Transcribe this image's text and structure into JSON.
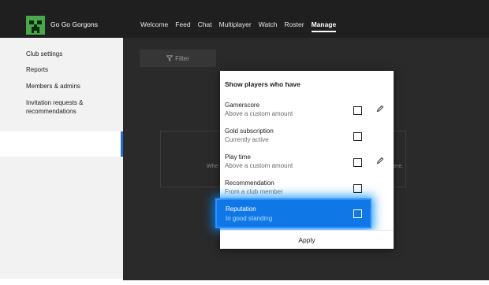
{
  "club": {
    "name": "Go Go Gorgons",
    "logo_icon": "creeper-face-icon"
  },
  "nav": {
    "items": [
      "Welcome",
      "Feed",
      "Chat",
      "Multiplayer",
      "Watch",
      "Roster",
      "Manage"
    ],
    "active": "Manage"
  },
  "sidebar": {
    "items": [
      {
        "label": "Club settings"
      },
      {
        "label": "Reports"
      },
      {
        "label": "Members & admins"
      },
      {
        "label": "Invitation requests &",
        "label2": "recommendations",
        "selected": true
      }
    ]
  },
  "main": {
    "filter_label": "Filter",
    "filter_icon": "filter-funnel-icon",
    "empty_left": "Whe",
    "empty_right": "ere."
  },
  "filter_panel": {
    "title": "Show players who have",
    "options": [
      {
        "title": "Gamerscore",
        "subtitle": "Above a custom amount",
        "checked": false,
        "editable": true
      },
      {
        "title": "Gold subscription",
        "subtitle": "Currently active",
        "checked": false,
        "editable": false
      },
      {
        "title": "Play time",
        "subtitle": "Above a custom amount",
        "checked": false,
        "editable": true
      },
      {
        "title": "Recommendation",
        "subtitle": "From a club member",
        "checked": false,
        "editable": false
      },
      {
        "title": "Reputation",
        "subtitle": "In good standing",
        "checked": false,
        "focused": true
      }
    ],
    "apply_label": "Apply"
  },
  "colors": {
    "topbar": "#1f1f1f",
    "content_bg": "#2a2a2a",
    "sidebar_bg": "#f2f2f2",
    "accent": "#1f6fd8",
    "focus": "#0f78e6",
    "logo_green": "#4aa84a"
  }
}
